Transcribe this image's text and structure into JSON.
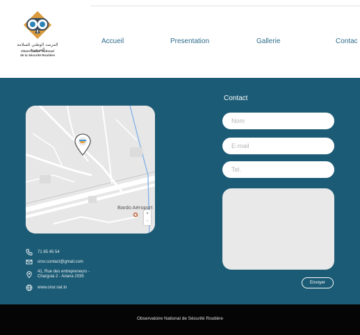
{
  "header": {
    "logo": {
      "arabic_name": "المرصد الوطني للسلامة المرورية",
      "french_lines": [
        "Observatoire National",
        "de la Sécurité Routière"
      ]
    },
    "nav": [
      {
        "label": "Accueil"
      },
      {
        "label": "Presentation"
      },
      {
        "label": "Gallerie"
      },
      {
        "label": "Contac"
      }
    ]
  },
  "map": {
    "place_label": "Bardo Aéroport",
    "zoom_in": "+",
    "zoom_out": "-"
  },
  "contact_info": {
    "phone": "71 85 45 54",
    "email": "onsr.contact@gmail.com",
    "address_lines": [
      "41, Rue des entrepreneurs -",
      "Charguia 2 - Ariana 2035"
    ],
    "website": "www.onsr.nat.tn"
  },
  "form": {
    "title": "Contact",
    "name_placeholder": "Nom",
    "email_placeholder": "E-mail",
    "phone_placeholder": "Tel.",
    "submit_label": "Envoyer"
  },
  "footer": {
    "text": "Observatoire National de Sécurité Routière"
  },
  "colors": {
    "primary": "#1b5b75",
    "nav_text": "#2e6b8a",
    "footer_bg": "#050505"
  }
}
